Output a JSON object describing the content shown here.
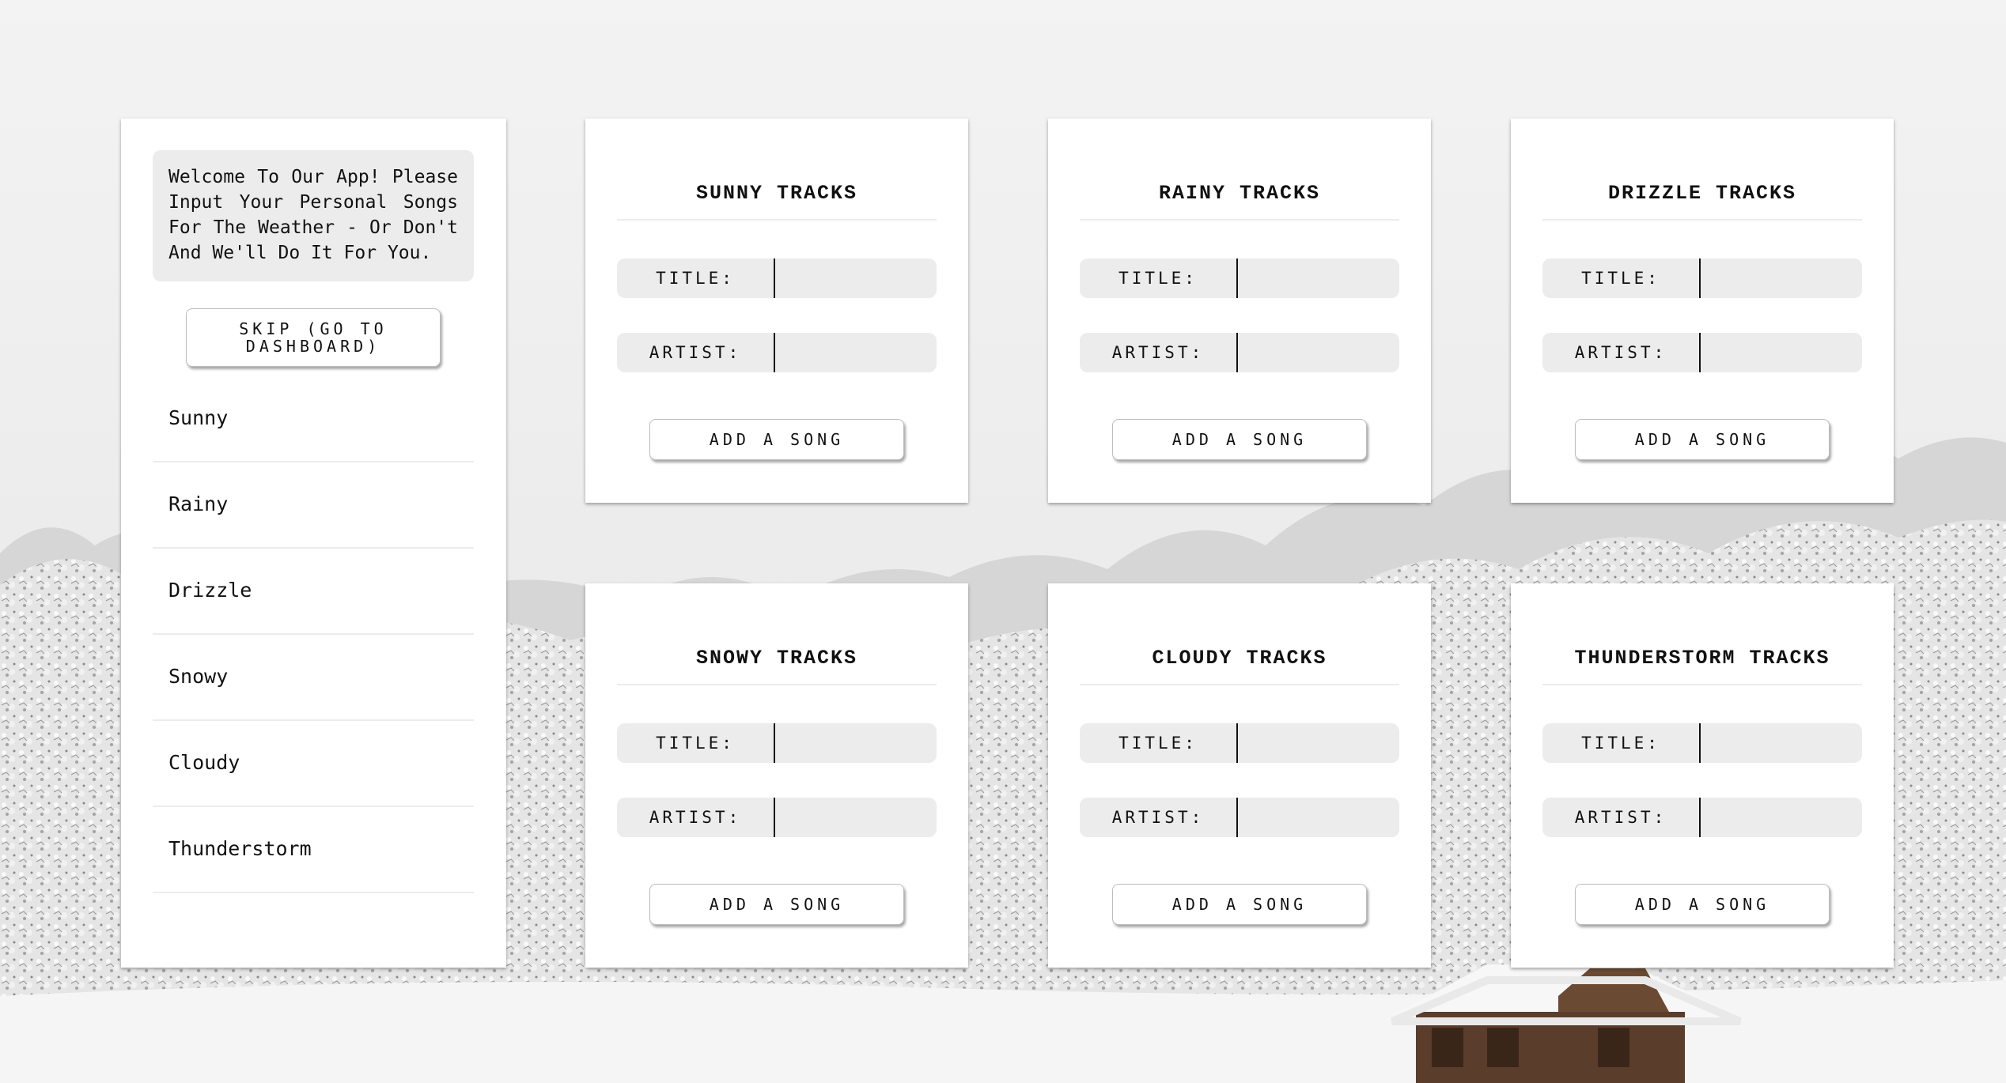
{
  "sidebar": {
    "welcome_text": "Welcome To Our App! Please Input Your Personal Songs For The Weather - Or Don't And We'll Do It For You.",
    "skip_label": "SKIP (GO TO DASHBOARD)",
    "items": [
      {
        "label": "Sunny"
      },
      {
        "label": "Rainy"
      },
      {
        "label": "Drizzle"
      },
      {
        "label": "Snowy"
      },
      {
        "label": "Cloudy"
      },
      {
        "label": "Thunderstorm"
      }
    ]
  },
  "cards": [
    {
      "title": "SUNNY TRACKS",
      "title_label": "TITLE:",
      "artist_label": "ARTIST:",
      "title_value": "",
      "artist_value": "",
      "button_label": "ADD A SONG"
    },
    {
      "title": "RAINY TRACKS",
      "title_label": "TITLE:",
      "artist_label": "ARTIST:",
      "title_value": "",
      "artist_value": "",
      "button_label": "ADD A SONG"
    },
    {
      "title": "DRIZZLE TRACKS",
      "title_label": "TITLE:",
      "artist_label": "ARTIST:",
      "title_value": "",
      "artist_value": "",
      "button_label": "ADD A SONG"
    },
    {
      "title": "SNOWY TRACKS",
      "title_label": "TITLE:",
      "artist_label": "ARTIST:",
      "title_value": "",
      "artist_value": "",
      "button_label": "ADD A SONG"
    },
    {
      "title": "CLOUDY TRACKS",
      "title_label": "TITLE:",
      "artist_label": "ARTIST:",
      "title_value": "",
      "artist_value": "",
      "button_label": "ADD A SONG"
    },
    {
      "title": "THUNDERSTORM TRACKS",
      "title_label": "TITLE:",
      "artist_label": "ARTIST:",
      "title_value": "",
      "artist_value": "",
      "button_label": "ADD A SONG"
    }
  ],
  "colors": {
    "field_background": "#ececec",
    "card_background": "#ffffff",
    "page_background": "#f1f1f1"
  }
}
